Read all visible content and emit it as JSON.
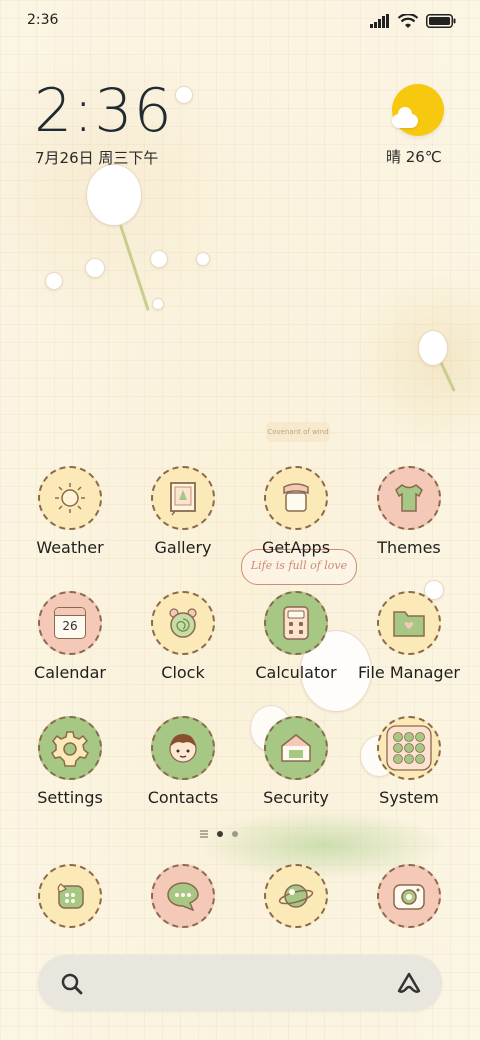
{
  "status_bar": {
    "time": "2:36"
  },
  "clock_widget": {
    "time": "2:36",
    "date": "7月26日 周三下午"
  },
  "weather_widget": {
    "text": "晴 26℃"
  },
  "decor": {
    "speech_bubble": "Life is full of love",
    "tag": "Covenant of wind"
  },
  "apps": [
    {
      "label": "Weather",
      "icon": "sun-icon",
      "bg": "cream"
    },
    {
      "label": "Gallery",
      "icon": "picture-frame-icon",
      "bg": "cream"
    },
    {
      "label": "GetApps",
      "icon": "jar-icon",
      "bg": "cream"
    },
    {
      "label": "Themes",
      "icon": "tshirt-icon",
      "bg": "pink"
    },
    {
      "label": "Calendar",
      "icon": "calendar-icon",
      "bg": "pink",
      "value": "26"
    },
    {
      "label": "Clock",
      "icon": "alarm-clock-icon",
      "bg": "cream"
    },
    {
      "label": "Calculator",
      "icon": "calculator-icon",
      "bg": "green"
    },
    {
      "label": "File Manager",
      "icon": "folder-icon",
      "bg": "cream"
    },
    {
      "label": "Settings",
      "icon": "gear-icon",
      "bg": "green"
    },
    {
      "label": "Contacts",
      "icon": "face-icon",
      "bg": "green"
    },
    {
      "label": "Security",
      "icon": "shield-house-icon",
      "bg": "green"
    },
    {
      "label": "System",
      "icon": "app-grid-icon",
      "bg": "cream"
    }
  ],
  "dock": [
    {
      "name": "phone",
      "icon": "phone-icon"
    },
    {
      "name": "messages",
      "icon": "message-bubble-icon"
    },
    {
      "name": "browser",
      "icon": "planet-icon"
    },
    {
      "name": "camera",
      "icon": "camera-icon"
    }
  ],
  "search": {
    "search_icon": "search-icon",
    "assistant_icon": "assistant-icon"
  },
  "colors": {
    "accent_green": "#a7c785",
    "accent_pink": "#f5c9b7",
    "accent_cream": "#fbe9b8",
    "sun": "#f6c90e"
  }
}
